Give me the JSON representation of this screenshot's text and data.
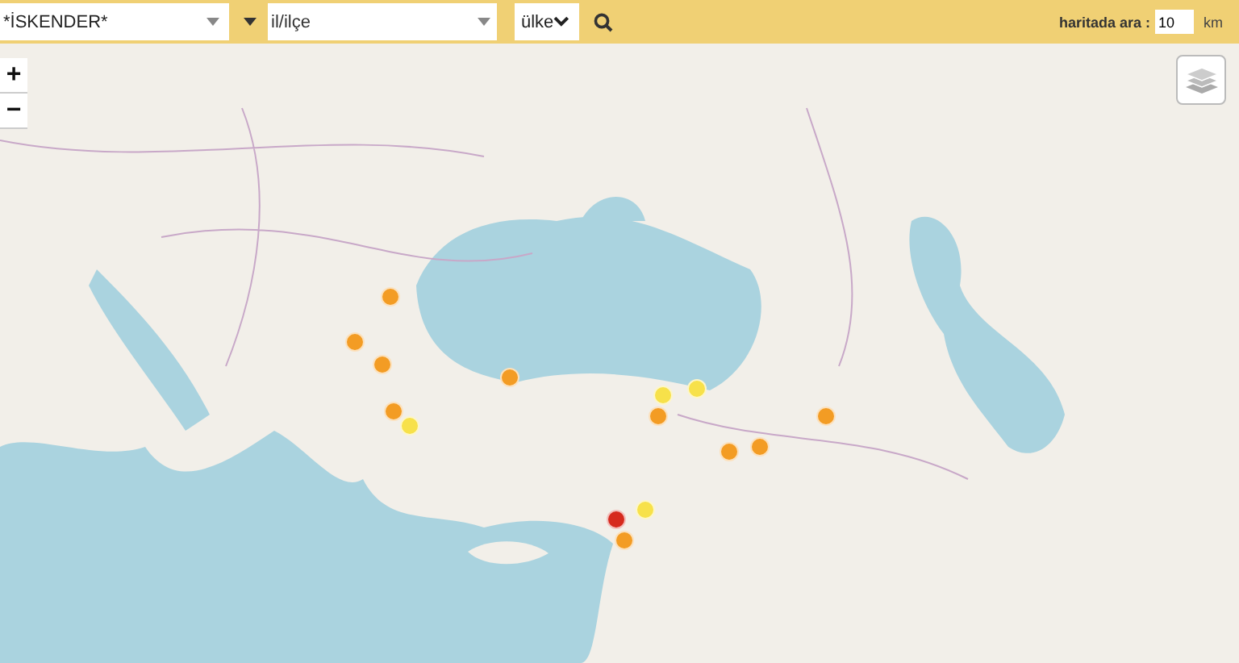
{
  "toolbar": {
    "name_field": {
      "value": "*İSKENDER*"
    },
    "district_field": {
      "placeholder": "il/ilçe"
    },
    "country_select": {
      "value": "ülke"
    },
    "radius_label": "haritada ara :",
    "radius_field": {
      "value": "10"
    },
    "radius_unit": "km"
  },
  "map": {
    "zoom_in": "+",
    "zoom_out": "−",
    "markers": [
      {
        "color": "#f39c24"
      },
      {
        "color": "#f39c24"
      },
      {
        "color": "#f39c24"
      },
      {
        "color": "#f39c24"
      },
      {
        "color": "#f39c24"
      },
      {
        "color": "#f7e14a"
      },
      {
        "color": "#f7e14a"
      },
      {
        "color": "#f39c24"
      },
      {
        "color": "#f7e14a"
      },
      {
        "color": "#f39c24"
      },
      {
        "color": "#f39c24"
      },
      {
        "color": "#f39c24"
      },
      {
        "color": "#f7e14a"
      },
      {
        "color": "#d62a1e"
      },
      {
        "color": "#f39c24"
      }
    ]
  }
}
